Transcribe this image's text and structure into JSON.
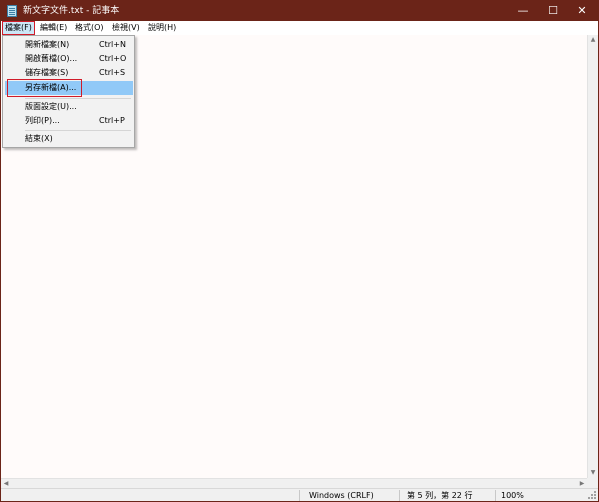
{
  "window": {
    "title": "新文字文件.txt - 記事本",
    "controls": {
      "minimize": "—",
      "maximize": "☐",
      "close": "✕"
    },
    "title_bar_color": "#6b2418"
  },
  "menubar": {
    "items": [
      {
        "label": "檔案(F)",
        "active": true
      },
      {
        "label": "編輯(E)"
      },
      {
        "label": "格式(O)"
      },
      {
        "label": "檢視(V)"
      },
      {
        "label": "說明(H)"
      }
    ]
  },
  "file_menu": {
    "items": [
      {
        "label": "開新檔案(N)",
        "shortcut": "Ctrl+N"
      },
      {
        "label": "開啟舊檔(O)...",
        "shortcut": "Ctrl+O"
      },
      {
        "label": "儲存檔案(S)",
        "shortcut": "Ctrl+S"
      },
      {
        "label": "另存新檔(A)...",
        "shortcut": "",
        "highlighted": true
      },
      {
        "label": "版面設定(U)...",
        "shortcut": ""
      },
      {
        "label": "列印(P)...",
        "shortcut": "Ctrl+P"
      },
      {
        "label": "結束(X)",
        "shortcut": ""
      }
    ]
  },
  "editor": {
    "content": ""
  },
  "statusbar": {
    "line_ending": "Windows (CRLF)",
    "position": "第 5 列，第 22 行",
    "zoom": "100%"
  },
  "colors": {
    "highlight": "#91c9f7",
    "annotation_outline": "#d01c2a"
  }
}
